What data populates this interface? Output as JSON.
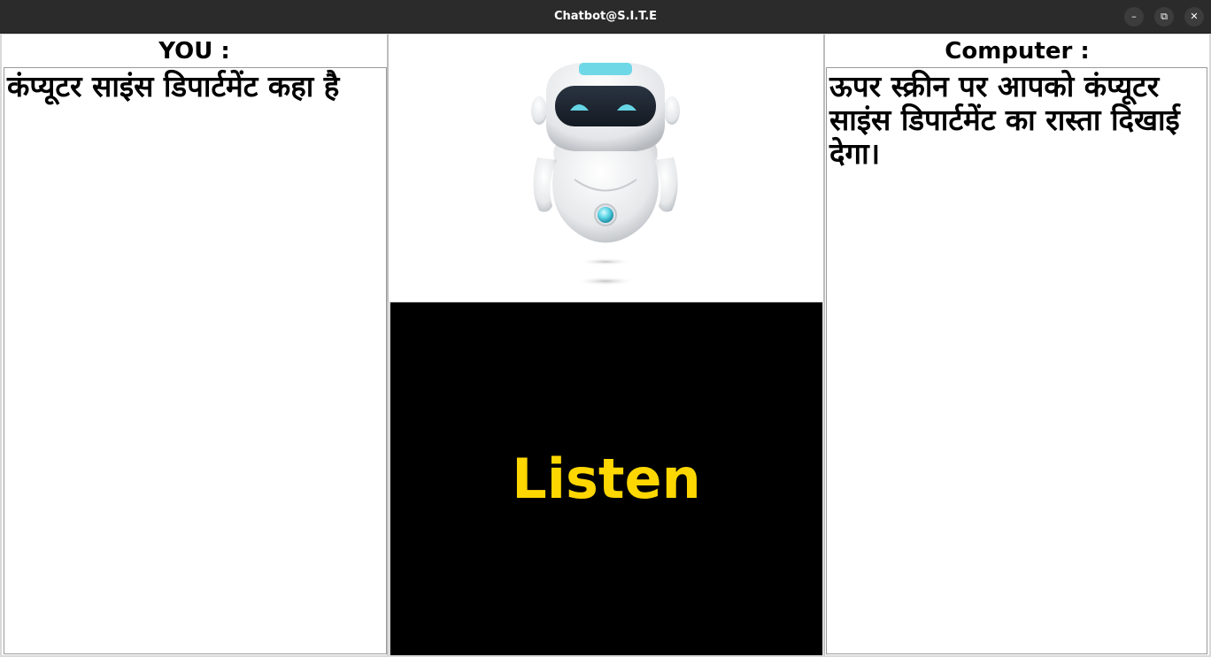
{
  "window": {
    "title": "Chatbot@S.I.T.E",
    "minimize_icon": "–",
    "maximize_icon": "⧉",
    "close_icon": "✕"
  },
  "you_panel": {
    "header": "YOU :",
    "text": "कंप्यूटर साइंस डिपार्टमेंट कहा है"
  },
  "computer_panel": {
    "header": "Computer :",
    "text": "ऊपर स्क्रीन पर आपको कंप्यूटर साइंस डिपार्टमेंट का रास्ता दिखाई देगा।"
  },
  "listen_button": {
    "label": "Listen",
    "text_color": "#ffd700",
    "background": "#000000"
  },
  "robot_image": {
    "icon": "robot-illustration"
  }
}
